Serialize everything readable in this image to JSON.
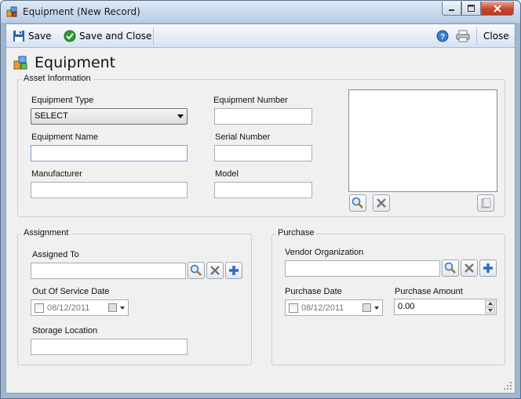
{
  "window": {
    "title": "Equipment (New Record)"
  },
  "toolbar": {
    "save": "Save",
    "save_and_close": "Save and Close",
    "close": "Close"
  },
  "heading": "Equipment",
  "asset": {
    "group_label": "Asset Information",
    "equipment_type_label": "Equipment Type",
    "equipment_type_value": "SELECT",
    "equipment_name_label": "Equipment Name",
    "equipment_name_value": "",
    "manufacturer_label": "Manufacturer",
    "manufacturer_value": "",
    "equipment_number_label": "Equipment Number",
    "equipment_number_value": "",
    "serial_number_label": "Serial Number",
    "serial_number_value": "",
    "model_label": "Model",
    "model_value": ""
  },
  "assignment": {
    "group_label": "Assignment",
    "assigned_to_label": "Assigned To",
    "assigned_to_value": "",
    "out_of_service_label": "Out Of Service Date",
    "out_of_service_value": "08/12/2011",
    "storage_location_label": "Storage Location",
    "storage_location_value": ""
  },
  "purchase": {
    "group_label": "Purchase",
    "vendor_label": "Vendor Organization",
    "vendor_value": "",
    "purchase_date_label": "Purchase Date",
    "purchase_date_value": "08/12/2011",
    "purchase_amount_label": "Purchase Amount",
    "purchase_amount_value": "0.00"
  },
  "icons": {
    "window": "app-icon",
    "save": "floppy-disk-icon",
    "save_and_close": "green-check-icon",
    "help": "help-icon",
    "print": "printer-icon",
    "heading": "equipment-icon",
    "lookup": "magnifier-icon",
    "clear": "clear-x-icon",
    "add": "plus-icon"
  },
  "colors": {
    "accent_blue": "#2b6cc4",
    "check_green": "#2e9b2e",
    "close_red": "#c9452b"
  }
}
